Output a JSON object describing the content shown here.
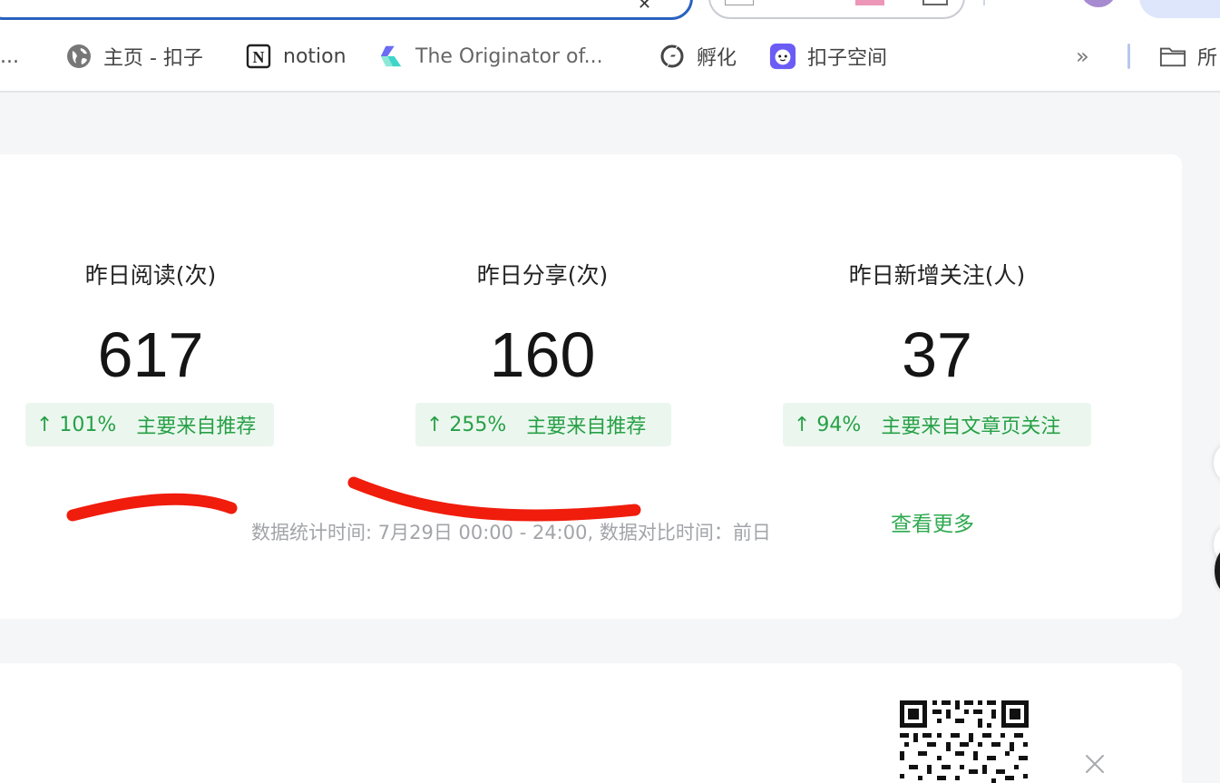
{
  "browser": {
    "bookmarks": [
      {
        "label": "主页 - 扣子",
        "icon": "globe-icon"
      },
      {
        "label": "notion",
        "icon": "notion-icon"
      },
      {
        "label": "The Originator of...",
        "icon": "originator-logo-icon"
      },
      {
        "label": "孵化",
        "icon": "lightning-circle-icon"
      },
      {
        "label": "扣子空间",
        "icon": "coze-space-icon"
      }
    ],
    "overflow_label": "...",
    "more_chevron": "»",
    "folder_label": "所"
  },
  "stats": [
    {
      "label": "昨日阅读(次)",
      "value": "617",
      "change": "↑ 101%",
      "source": "主要来自推荐"
    },
    {
      "label": "昨日分享(次)",
      "value": "160",
      "change": "↑ 255%",
      "source": "主要来自推荐"
    },
    {
      "label": "昨日新增关注(人)",
      "value": "37",
      "change": "↑ 94%",
      "source": "主要来自文章页关注"
    }
  ],
  "footer_note": "数据统计时间: 7月29日 00:00 - 24:00, 数据对比时间：前日",
  "see_more": "查看更多",
  "colors": {
    "accent_green": "#27a047",
    "badge_bg": "#ebf7ee",
    "annotation_red": "#f01c0c",
    "url_border": "#2a62bf"
  }
}
